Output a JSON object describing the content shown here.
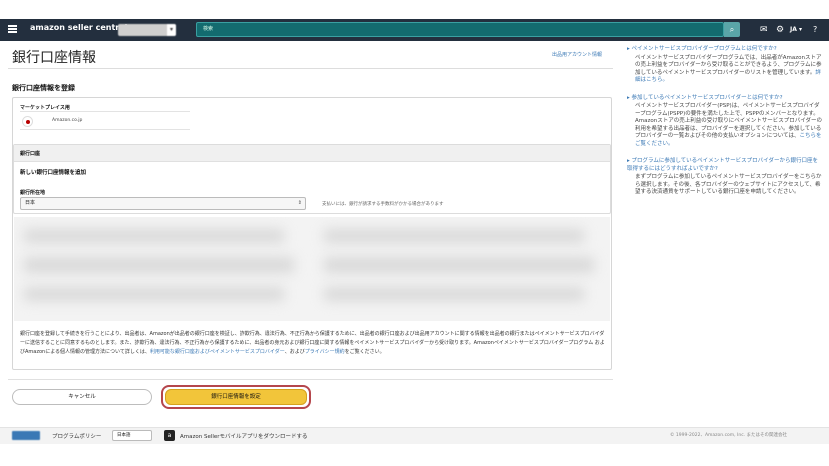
{
  "header": {
    "logo": "amazon seller central",
    "search_placeholder": "検索",
    "lang": "JA ▾",
    "icons": [
      "menu-icon",
      "search-icon",
      "mail-icon",
      "gear-icon",
      "help-icon"
    ]
  },
  "page": {
    "title": "銀行口座情報",
    "guide_link": "出品用アカウント情報",
    "section_title": "銀行口座情報を登録",
    "marketplace_label": "マーケットプレイス用",
    "marketplace_name": "Amazon.co.jp",
    "bank_section_label": "銀行口座",
    "add_bank_label": "新しい銀行口座情報を追加",
    "location_label": "銀行所在地",
    "location_value": "日本",
    "location_note": "支払いには、銀行が請求する手数料がかかる場合があります",
    "disclaimer_text": "銀行口座を登録して手続きを行うことにより、出品者は、Amazonが出品者の銀行口座を検証し、詐欺行為、違法行為、不正行為から保護するために、出品者の銀行口座および出品用アカウントに関する情報を出品者の銀行またはペイメントサービスプロバイダーに送信することに同意するものとします。また、詐欺行為、違法行為、不正行為から保護するために、出品者の身元および銀行口座に関する情報をペイメントサービスプロバイダーから受け取ります。Amazonペイメントサービスプロバイダープログラム およびAmazonによる個人情報の管理方法について詳しくは、",
    "disclaimer_link1": "利用可能な銀行口座およびペイメントサービスプロバイダー",
    "disclaimer_mid": "、および",
    "disclaimer_link2": "プライバシー規約",
    "disclaimer_end": "をご覧ください。",
    "cancel_label": "キャンセル",
    "submit_label": "銀行口座情報を設定"
  },
  "sidebar": [
    {
      "q": "ペイメントサービスプロバイダープログラムとは何ですか?",
      "a": "ペイメントサービスプロバイダープログラムでは、出品者がAmazonストアの売上利益をプロバイダーから受け取ることができるよう、プログラムに参加しているペイメントサービスプロバイダーのリストを管理しています。",
      "link": "詳細はこちら。"
    },
    {
      "q": "参加しているペイメントサービスプロバイダーとは何ですか?",
      "a": "ペイメントサービスプロバイダー(PSP)は、ペイメントサービスプロバイダープログラム(PSPP)の要件を満たした上で、PSPPのメンバーとなります。Amazonストアの売上利益の受け取りにペイメントサービスプロバイダーの利用を希望する出品者は、プロバイダーを選択してください。参加しているプロバイダーの一覧およびその他の支払いオプションについては、",
      "link": "こちらをご覧ください。"
    },
    {
      "q": "プログラムに参加しているペイメントサービスプロバイダーから銀行口座を取得するにはどうすればよいですか?",
      "a": "まずプログラムに参加しているペイメントサービスプロバイダーをこちらから選択します。その後、各プロバイダーのウェブサイトにアクセスして、希望する決済通貨をサポートしている銀行口座を申請してください。",
      "link": ""
    }
  ],
  "footer": {
    "help_label": "",
    "policy": "プログラムポリシー",
    "language": "日本語",
    "mobile": "Amazon Sellerモバイルアプリをダウンロードする",
    "copyright": "© 1999-2022、Amazon.com, Inc. またはその関連会社"
  }
}
